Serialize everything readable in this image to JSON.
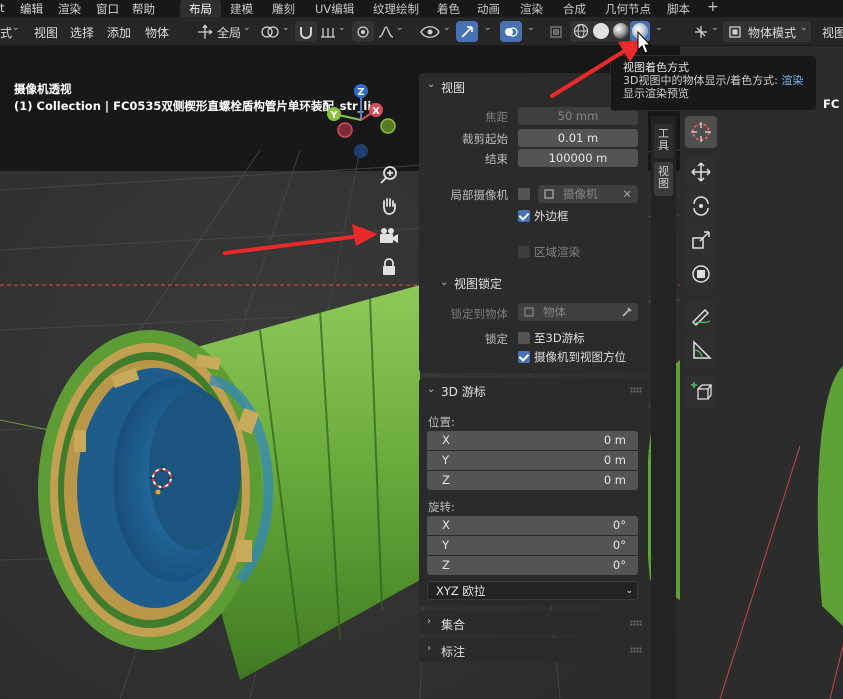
{
  "menubar": {
    "items": [
      "t",
      "编辑",
      "渲染",
      "窗口",
      "帮助"
    ],
    "workspace_tabs": [
      "布局",
      "建模",
      "雕刻",
      "UV编辑",
      "纹理绘制",
      "着色",
      "动画",
      "渲染",
      "合成",
      "几何节点",
      "脚本"
    ],
    "add_tab": "+"
  },
  "header": {
    "mode_fragment": "式",
    "menus": [
      "视图",
      "选择",
      "添加",
      "物体"
    ],
    "orientation": "全局",
    "object_mode": "物体模式",
    "view_menu": "视图"
  },
  "viewport": {
    "camera_label": "摄像机透视",
    "collection_label": "(1) Collection | FC0535双侧楔形直螺栓盾构管片单环装配_str_lin",
    "right_label_fragment": "FC",
    "gizmo": {
      "z": "Z",
      "y": "Y",
      "x": "X"
    }
  },
  "tooltip": {
    "title": "视图着色方式",
    "desc_prefix": "3D视图中的物体显示/着色方式: ",
    "desc_highlight": "渲染",
    "line3": "显示渲染预览"
  },
  "sidebar": {
    "view_panel": {
      "title": "视图",
      "focal_length_label": "焦距",
      "focal_length_value": "50 mm",
      "clip_start_label": "裁剪起始",
      "clip_start_value": "0.01 m",
      "clip_end_label": "结束",
      "clip_end_value": "100000 m",
      "local_camera_label": "局部摄像机",
      "local_camera_placeholder": "摄像机",
      "clear_x": "✕",
      "border_label": "外边框",
      "border_checked": true,
      "region_render_label": "区域渲染",
      "region_render_checked": false
    },
    "view_lock": {
      "title": "视图锁定",
      "lock_to_object_label": "锁定到物体",
      "lock_to_object_placeholder": "物体",
      "lock_label": "锁定",
      "to_3d_cursor_label": "至3D游标",
      "to_3d_cursor_checked": false,
      "camera_to_view_label": "摄像机到视图方位",
      "camera_to_view_checked": true
    },
    "cursor_panel": {
      "title": "3D 游标",
      "location_label": "位置:",
      "location": [
        {
          "axis": "X",
          "value": "0 m"
        },
        {
          "axis": "Y",
          "value": "0 m"
        },
        {
          "axis": "Z",
          "value": "0 m"
        }
      ],
      "rotation_label": "旋转:",
      "rotation": [
        {
          "axis": "X",
          "value": "0°"
        },
        {
          "axis": "Y",
          "value": "0°"
        },
        {
          "axis": "Z",
          "value": "0°"
        }
      ],
      "rotation_mode": "XYZ 欧拉"
    },
    "collections_panel": {
      "title": "集合"
    },
    "annotations_panel": {
      "title": "标注"
    }
  },
  "side_tabs": [
    "工具",
    "视图"
  ],
  "colors": {
    "accent_blue": "#4772b3",
    "pipe_green": "#6aab3c",
    "pipe_blue": "#1f5f8f",
    "pipe_tan": "#c1a052",
    "arrow_red": "#e82a2a",
    "tooltip_highlight": "#7fb2ea"
  }
}
